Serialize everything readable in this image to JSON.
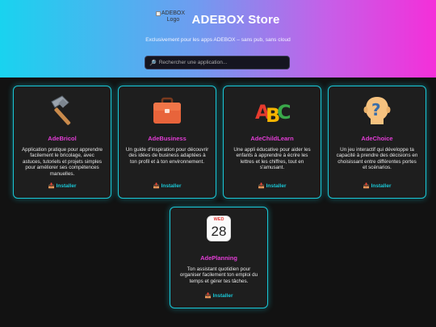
{
  "header": {
    "logo_alt": "ADEBOX Logo",
    "title": "ADEBOX Store",
    "tagline": "Exclusivement pour les apps ADEBOX – sans pub, sans cloud",
    "search_placeholder": "Rechercher une application..."
  },
  "colors": {
    "accent": "#19c7d6",
    "app_name": "#e33dd6",
    "card_bg": "#1e1e1e",
    "page_bg": "#121212"
  },
  "apps": [
    {
      "name": "AdeBricol",
      "icon": "hammer-icon",
      "description": "Application pratique pour apprendre facilement le bricolage, avec astuces, tutoriels et projets simples pour améliorer ses compétences manuelles.",
      "install_label": "Installer"
    },
    {
      "name": "AdeBusiness",
      "icon": "briefcase-icon",
      "description": "Un guide d'inspiration pour découvrir des idées de business adaptées à ton profil et à ton environnement.",
      "install_label": "Installer"
    },
    {
      "name": "AdeChildLearn",
      "icon": "abc-icon",
      "description": "Une appli éducative pour aider les enfants à apprendre à écrire les lettres et les chiffres, tout en s'amusant.",
      "install_label": "Installer"
    },
    {
      "name": "AdeChoice",
      "icon": "question-head-icon",
      "description": "Un jeu interactif qui développe ta capacité à prendre des décisions en choisissant entre différentes portes et scénarios.",
      "install_label": "Installer"
    },
    {
      "name": "AdePlanning",
      "icon": "calendar-icon",
      "calendar_weekday": "WED",
      "calendar_day": "28",
      "description": "Ton assistant quotidien pour organiser facilement ton emploi du temps et gérer tes tâches.",
      "install_label": "Installer"
    }
  ]
}
